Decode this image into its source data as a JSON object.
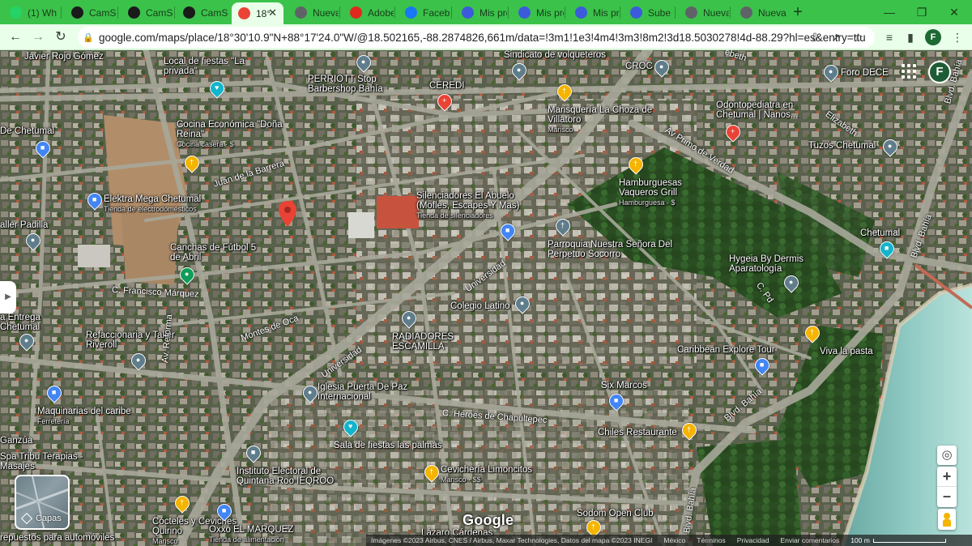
{
  "browser": {
    "tabs": [
      {
        "label": "(1) Wh",
        "icon": "whatsapp-icon",
        "color": "#25d366"
      },
      {
        "label": "CamSc",
        "icon": "camscanner-icon",
        "color": "#1a1a1a"
      },
      {
        "label": "CamSc",
        "icon": "camscanner-icon",
        "color": "#1a1a1a"
      },
      {
        "label": "CamSc",
        "icon": "camscanner-icon",
        "color": "#1a1a1a"
      },
      {
        "label": "18°",
        "icon": "maps-icon",
        "color": "#ea4335",
        "active": true
      },
      {
        "label": "Nueva",
        "icon": "chrome-icon",
        "color": "#5f6368"
      },
      {
        "label": "Adobe",
        "icon": "adobe-icon",
        "color": "#e0281e"
      },
      {
        "label": "Facebo",
        "icon": "facebook-icon",
        "color": "#1877f2"
      },
      {
        "label": "Mis pro",
        "icon": "eb-icon",
        "color": "#3b5bdb"
      },
      {
        "label": "Mis pro",
        "icon": "eb-icon",
        "color": "#3b5bdb"
      },
      {
        "label": "Mis pro",
        "icon": "eb-icon",
        "color": "#3b5bdb"
      },
      {
        "label": "Sube fo",
        "icon": "eb-icon",
        "color": "#3b5bdb"
      },
      {
        "label": "Nueva",
        "icon": "chrome-icon",
        "color": "#5f6368"
      },
      {
        "label": "Nueva",
        "icon": "chrome-icon",
        "color": "#5f6368"
      }
    ],
    "url": "google.com/maps/place/18°30'10.9\"N+88°17'24.0\"W/@18.502165,-88.2874826,661m/data=!3m1!1e3!4m4!3m3!8m2!3d18.5030278!4d-88.29?hl=es&entry=ttu",
    "profile_initial": "F",
    "accent": "#3bc24a"
  },
  "map": {
    "account_initial": "F",
    "layers_label": "Capas",
    "google_logo": "Google",
    "footer": {
      "attribution": "Imágenes ©2023 Airbus, CNES / Airbus, Maxar Technologies, Datos del mapa ©2023 INEGI",
      "country": "México",
      "terms": "Términos",
      "privacy": "Privacidad",
      "feedback": "Enviar comentarios",
      "scale": "100 m"
    },
    "places": [
      {
        "name": "Javier Rojo Gómez",
        "sub": ""
      },
      {
        "name": "Local de fiestas \"La privada\"",
        "sub": ""
      },
      {
        "name": "PERRIOTT Stop Barbershop Bahía",
        "sub": ""
      },
      {
        "name": "Sindicato de volqueteros",
        "sub": ""
      },
      {
        "name": "CROC",
        "sub": ""
      },
      {
        "name": "CEREDI",
        "sub": ""
      },
      {
        "name": "Marisquería La Choza de Villatoro",
        "sub": "Marisco"
      },
      {
        "name": "Foro DECE",
        "sub": ""
      },
      {
        "name": "Odontopediatra en Chetumal | Nanos...",
        "sub": ""
      },
      {
        "name": "De Chetumal",
        "sub": ""
      },
      {
        "name": "Cocina Económica \"Doña Reina\"",
        "sub": "Cocina casera · $"
      },
      {
        "name": "Tuzos Chetumal",
        "sub": ""
      },
      {
        "name": "Hamburguesas Vaqueros Grill",
        "sub": "Hamburguesa · $"
      },
      {
        "name": "Elektra Mega Chetumal",
        "sub": "Tienda de electrodomésticos"
      },
      {
        "name": "Silenciadores El Abuelo (Mofles, Escapes Y Mas)",
        "sub": "Tienda de silenciadores"
      },
      {
        "name": "aller Padilla",
        "sub": ""
      },
      {
        "name": "Canchas de Fútbol 5 de Abril",
        "sub": ""
      },
      {
        "name": "Parroquia Nuestra Señora Del Perpetuo Socorro",
        "sub": ""
      },
      {
        "name": "Chetumal",
        "sub": ""
      },
      {
        "name": "Hygeia By Dermis Aparatología",
        "sub": ""
      },
      {
        "name": "a Entrega Chetumal",
        "sub": ""
      },
      {
        "name": "Colegio Latino",
        "sub": ""
      },
      {
        "name": "Refaccionaria y Taller Riveroll",
        "sub": ""
      },
      {
        "name": "RADIADORES ESCAMILLA",
        "sub": ""
      },
      {
        "name": "Caribbean Explore Tour",
        "sub": ""
      },
      {
        "name": "Viva la pasta",
        "sub": ""
      },
      {
        "name": "Iglesia Puerta De Paz Internacional",
        "sub": ""
      },
      {
        "name": "Six Marcos",
        "sub": ""
      },
      {
        "name": "Maquinarias del caribe",
        "sub": "Ferretería"
      },
      {
        "name": "Chiles Restaurante",
        "sub": ""
      },
      {
        "name": "Ganzúa",
        "sub": ""
      },
      {
        "name": "Sala de fiestas las palmas",
        "sub": ""
      },
      {
        "name": "Spa Tribu Terapias - Masajes",
        "sub": ""
      },
      {
        "name": "Instituto Electoral de Quintana Roo IEQROO",
        "sub": ""
      },
      {
        "name": "Cevichería Limoncitos",
        "sub": "Marisco · $$"
      },
      {
        "name": "Sodom Open Club",
        "sub": ""
      },
      {
        "name": "Cócteles y Ceviches Quirino",
        "sub": "Marisco"
      },
      {
        "name": "Oxxo EL MARQUEZ",
        "sub": "Tienda de alimentación"
      },
      {
        "name": "Lázaro Cárdenas",
        "sub": ""
      },
      {
        "name": "repuestos para automóviles",
        "sub": ""
      }
    ],
    "streets": [
      "Juan de la Barrera",
      "Av Primo de Verdad",
      "Elizabeth",
      "Blvd. Bahía",
      "Blvd. Bahía",
      "C. Francisco Márquez",
      "Av. Reforma",
      "Montes de Oca",
      "Universidad",
      "Universidad",
      "C. Héroes de Chapultepec",
      "Blvd. Bahía",
      "Blvd. Bahía",
      "C. Pd",
      "ebeth"
    ]
  }
}
